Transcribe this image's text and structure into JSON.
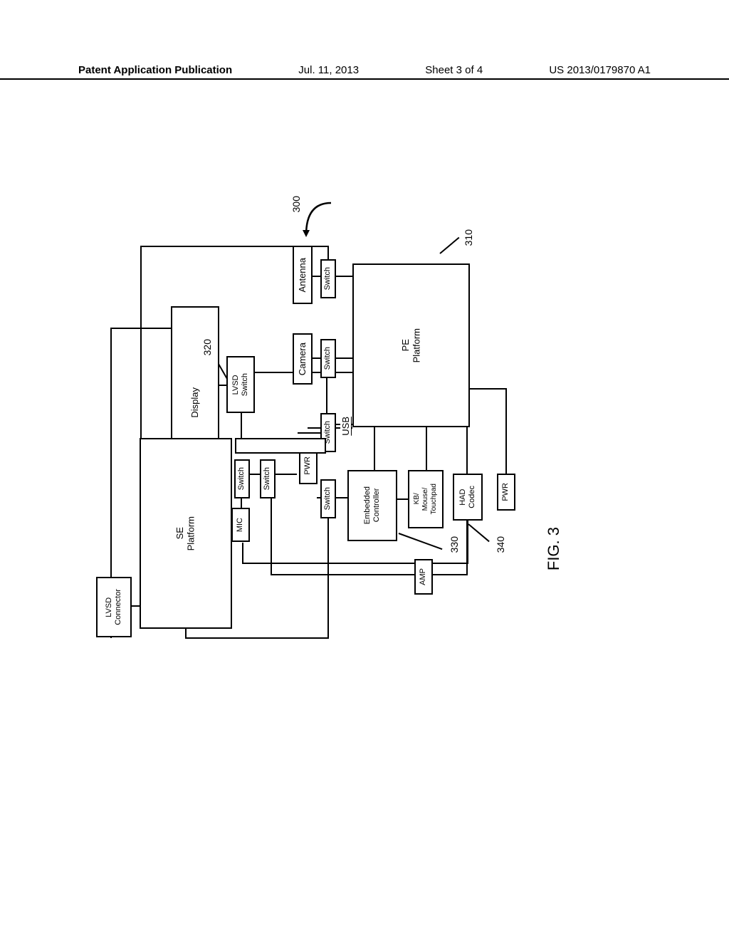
{
  "header": {
    "publication": "Patent Application Publication",
    "date": "Jul. 11, 2013",
    "sheet": "Sheet 3 of 4",
    "docnum": "US 2013/0179870 A1"
  },
  "figure": {
    "caption": "FIG. 3",
    "mainref": "300"
  },
  "refs": {
    "r310": "310",
    "r320": "320",
    "r330": "330",
    "r340": "340"
  },
  "blocks": {
    "pe_platform": "PE\nPlatform",
    "se_platform": "SE\nPlatform",
    "display": "Display",
    "antenna": "Antenna",
    "camera": "Camera",
    "lvsd_switch": "LVSD\nSwitch",
    "lvsd_connector": "LVSD\nConnector",
    "switch": "Switch",
    "embedded_controller": "Embedded\nController",
    "kb_mouse": "KB/\nMouse/\nTouchpad",
    "had_codec": "HAD\nCodec",
    "pwr": "PWR",
    "mic": "MIC",
    "amp": "AMP",
    "usb": "USB"
  }
}
